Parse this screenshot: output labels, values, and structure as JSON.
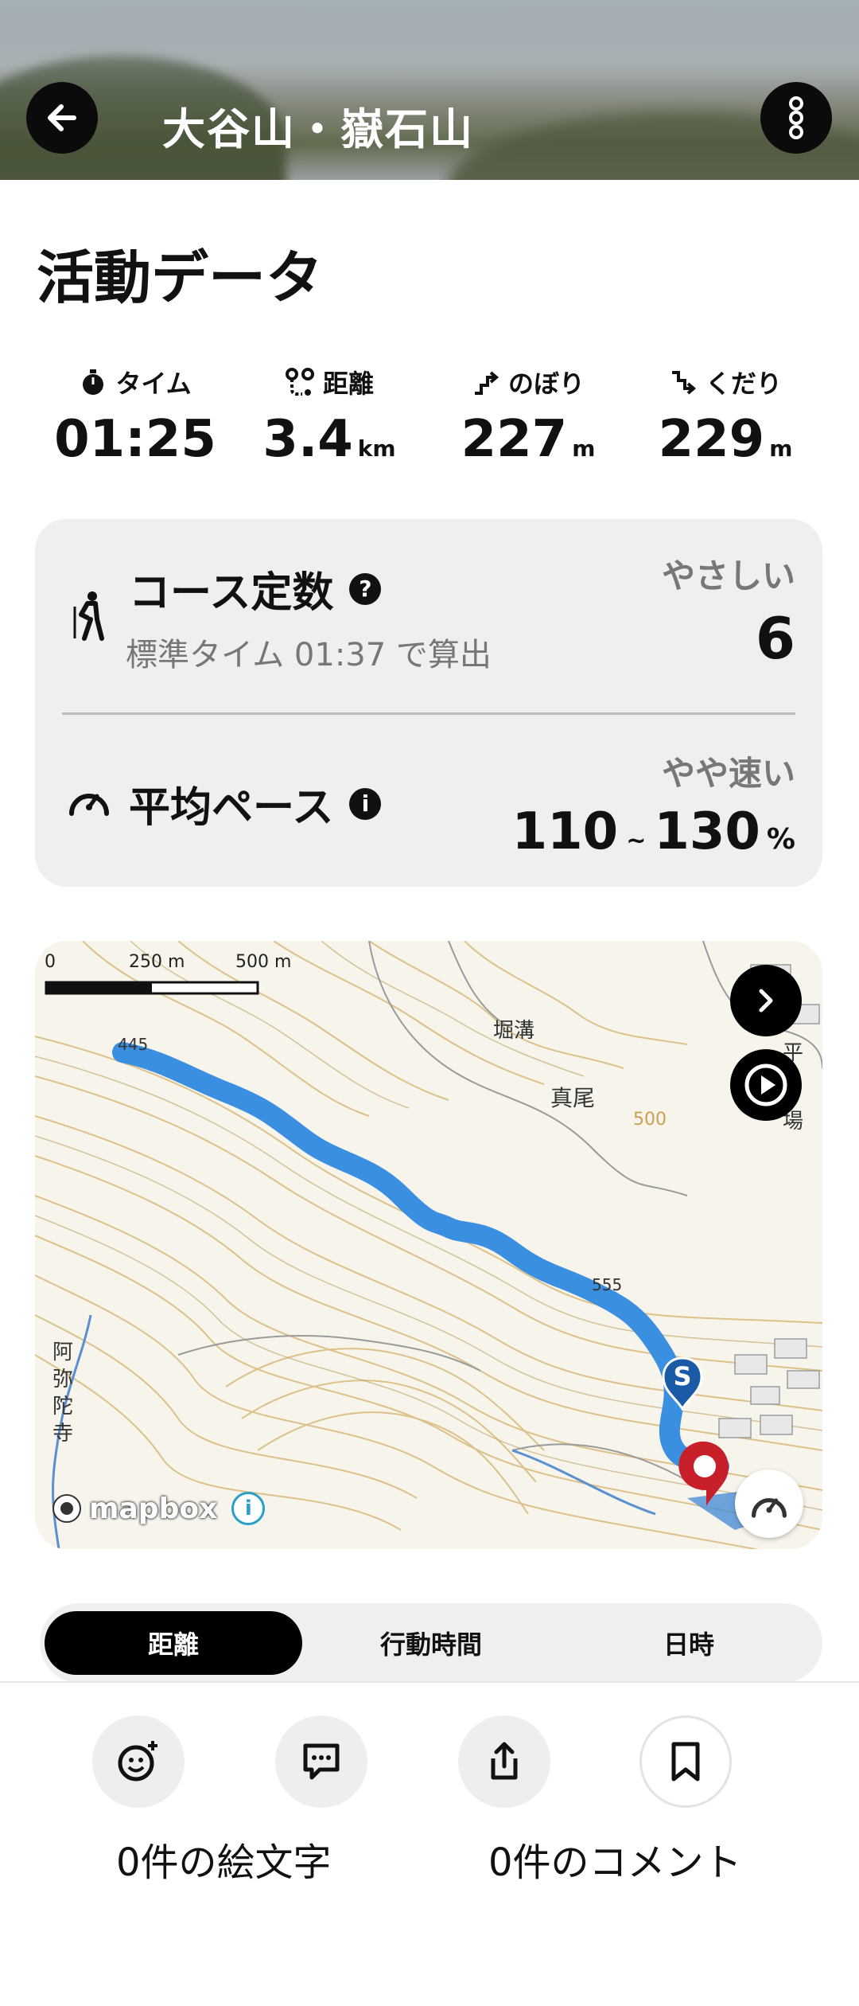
{
  "header": {
    "title": "大谷山・嶽石山"
  },
  "activity": {
    "section_title": "活動データ",
    "stats": [
      {
        "label": "タイム",
        "value": "01:25",
        "unit": "",
        "icon": "stopwatch-icon"
      },
      {
        "label": "距離",
        "value": "3.4",
        "unit": "km",
        "icon": "route-icon"
      },
      {
        "label": "のぼり",
        "value": "227",
        "unit": "m",
        "icon": "ascent-icon"
      },
      {
        "label": "くだり",
        "value": "229",
        "unit": "m",
        "icon": "descent-icon"
      }
    ]
  },
  "course": {
    "title": "コース定数",
    "help": "?",
    "subtitle": "標準タイム 01:37 で算出",
    "level": "やさしい",
    "value": "6"
  },
  "pace": {
    "title": "平均ペース",
    "info": "i",
    "level": "やや速い",
    "min": "110",
    "tilde": "~",
    "max": "130",
    "unit": "%"
  },
  "map": {
    "scale_labels": [
      "0",
      "250 m",
      "500 m"
    ],
    "place_labels": [
      "堀溝",
      "真尾",
      "阿",
      "弥",
      "陀",
      "寺",
      "平",
      "場"
    ],
    "peak_labels": [
      "445",
      "555",
      "500"
    ],
    "start_marker": "S",
    "attribution": "mapbox",
    "attribution_info": "i",
    "route_color": "#3b8fe0"
  },
  "tabs": {
    "items": [
      "距離",
      "行動時間",
      "日時"
    ],
    "active_index": 0
  },
  "bottom": {
    "emoji_count_text": "0件の絵文字",
    "comment_count_text": "0件のコメント"
  }
}
